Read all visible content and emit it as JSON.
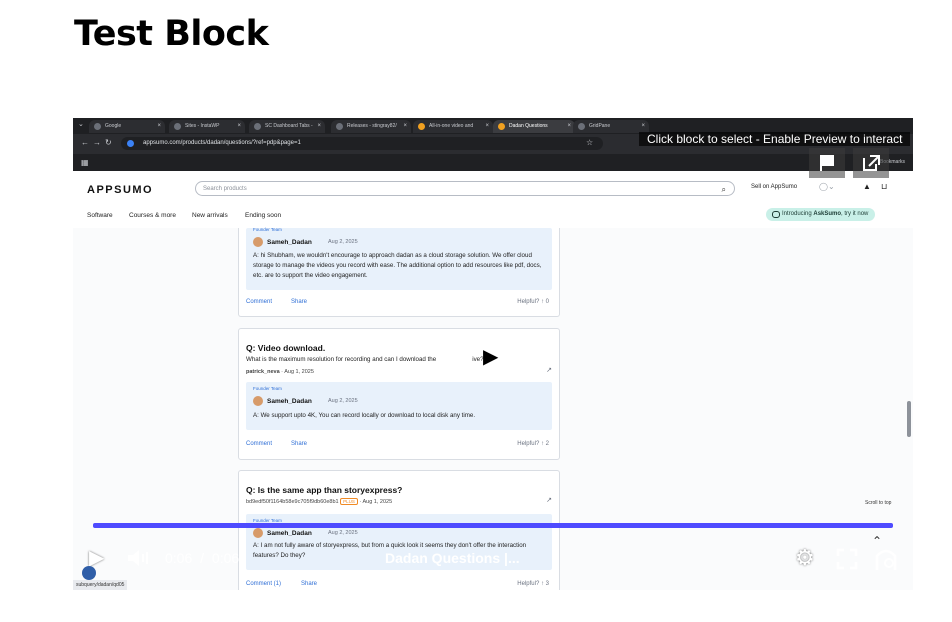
{
  "page": {
    "title": "Test Block"
  },
  "browser": {
    "tabs": [
      "Google",
      "Sites - InstaWP",
      "SC Dashboard Tabs -",
      "Releases - stingray82/",
      "All-in-one video and",
      "Dadan Questions",
      "GridPane"
    ],
    "active_tab_index": 5,
    "url": "appsumo.com/products/dadan/questions/?ref=pdp&page=1",
    "bookmarks_label": "Bookmarks"
  },
  "appsumo": {
    "logo": "APPSUMO",
    "search_placeholder": "Search products",
    "sell_label": "Sell on AppSumo",
    "nav": [
      "Software",
      "Courses & more",
      "New arrivals",
      "Ending soon"
    ],
    "ask_prefix": "Introducing ",
    "ask_name": "AskSumo",
    "ask_suffix": ", try it now"
  },
  "cards": [
    {
      "founder_label": "Founder Team",
      "author": "Sameh_Dadan",
      "date": "Aug 2, 2025",
      "answer": "A: hi Shubham, we wouldn't encourage to approach dadan as a cloud storage solution. We offer cloud storage to manage the videos you record with ease. The additional option to add resources like pdf, docs, etc. are to support the video engagement.",
      "comment": "Comment",
      "share": "Share",
      "helpful": "Helpful?",
      "votes": "0"
    },
    {
      "question": "Q: Video download.",
      "body": "What is the maximum resolution for recording and can I download the",
      "body_tail": "ive?",
      "asker": "patrick_neva",
      "asked": "Aug 1, 2025",
      "founder_label": "Founder Team",
      "author": "Sameh_Dadan",
      "date": "Aug 2, 2025",
      "answer": "A: We support upto 4K, You can record locally or download to local disk any time.",
      "comment": "Comment",
      "share": "Share",
      "helpful": "Helpful?",
      "votes": "2"
    },
    {
      "question": "Q: Is the same app than storyexpress?",
      "asker": "bd9edf50f1164b58e9c705f9db60e8b1",
      "badge": "PLUS",
      "asked": "Aug 1, 2025",
      "founder_label": "Founder Team",
      "author": "Sameh_Dadan",
      "date": "Aug 2, 2025",
      "answer": "A: I am not fully aware of storyexpress, but from a quick look it seems they don't offer the interaction features? Do they?",
      "comment": "Comment (1)",
      "share": "Share",
      "helpful": "Helpful?",
      "votes": "3"
    }
  ],
  "player": {
    "preview_tip": "Click block to select - Enable Preview to interact",
    "current_time": "0:06",
    "time_separator": "/",
    "duration": "0:06",
    "title": "Dadan Questions |...",
    "progress_fraction": 1.0,
    "scroll_to_top": "Scroll to top",
    "status_url": "subquery/dadan/qd05"
  },
  "colors": {
    "accent": "#4e4bff",
    "appsumo_pill": "#c9f0e8",
    "answer_bg": "#e8f1fb"
  },
  "icons": [
    "play-icon",
    "volume-icon",
    "settings-icon",
    "fullscreen-icon",
    "pip-icon",
    "flag-icon",
    "external-link-icon",
    "search-icon",
    "cart-icon",
    "bell-icon"
  ]
}
